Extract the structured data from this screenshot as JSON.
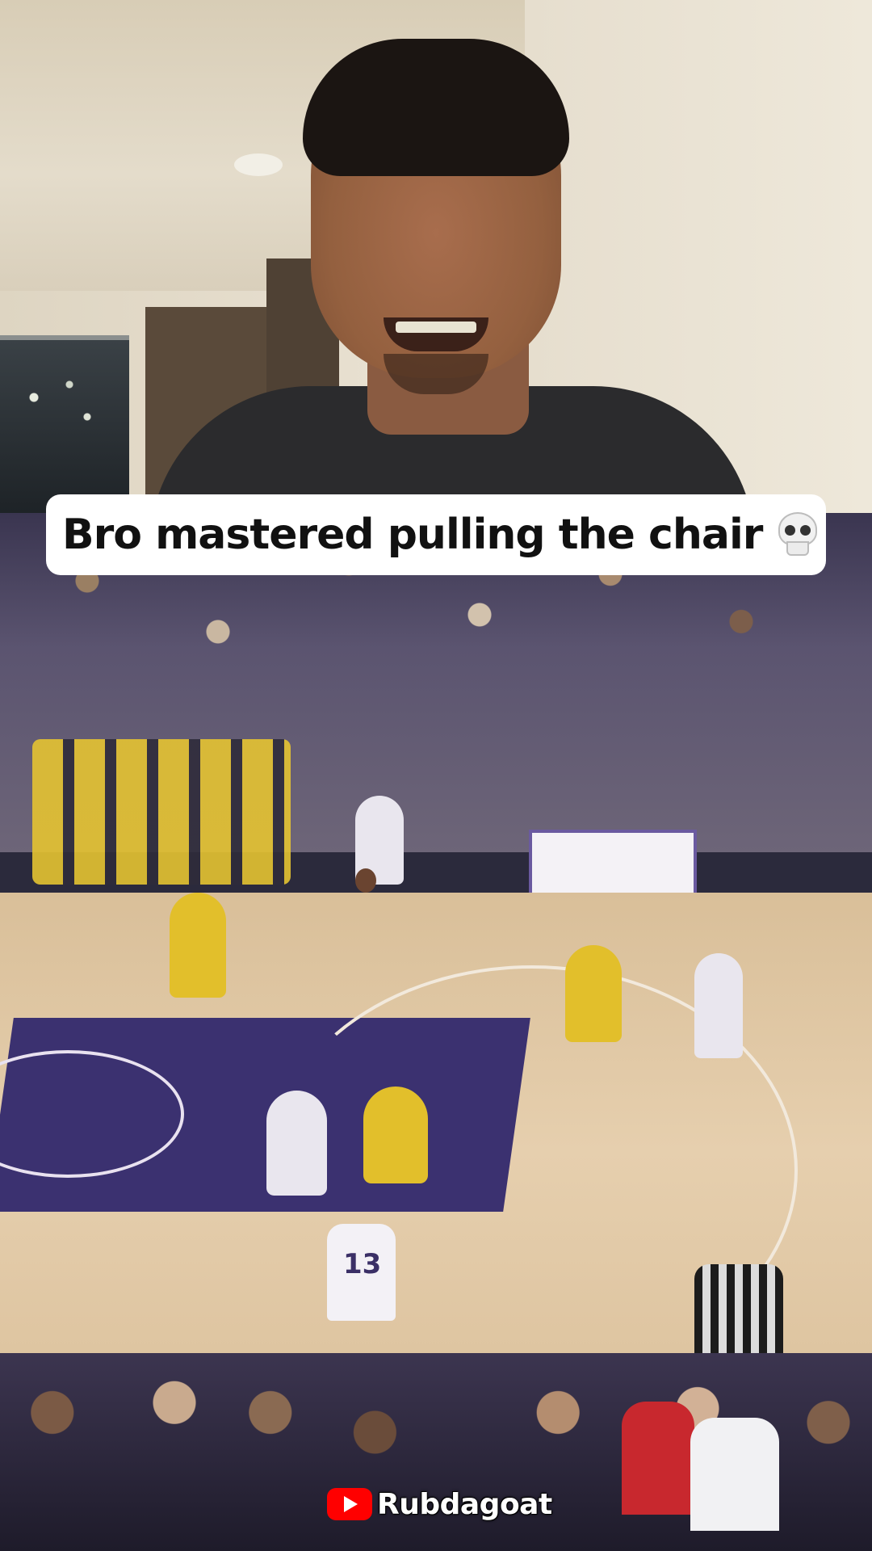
{
  "caption": {
    "text": "Bro mastered pulling the chair",
    "emoji_icon": "skull-icon"
  },
  "watermark": {
    "icon": "youtube-icon",
    "channel": "Rubdagoat",
    "icon_color": "#ff0000"
  },
  "game": {
    "jersey_number": "13"
  }
}
